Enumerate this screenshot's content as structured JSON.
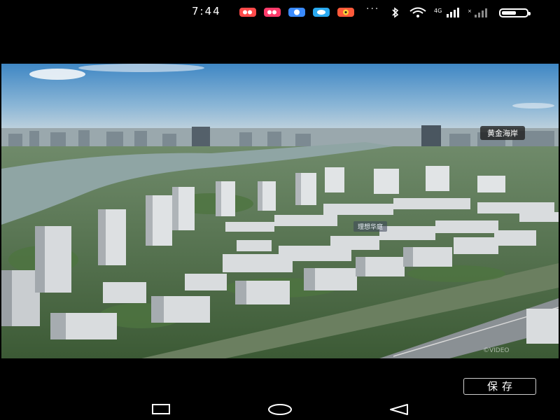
{
  "status_bar": {
    "time": "7:44",
    "more": "···",
    "notifications": [
      {
        "icon": "red-app-icon",
        "color": "#ff4a4a"
      },
      {
        "icon": "red-app-icon",
        "color": "#ff3b6b"
      },
      {
        "icon": "blue-app-icon",
        "color": "#3a8bff"
      },
      {
        "icon": "blue-app-icon",
        "color": "#29a9f0"
      },
      {
        "icon": "weibo-icon",
        "color": "#ff5a3a"
      }
    ],
    "network_label": "4G"
  },
  "media": {
    "place_tag": "黄金海岸",
    "mid_tag": "理想华庭",
    "watermark": "©VIDEO"
  },
  "actions": {
    "save_label": "保存"
  },
  "nav_bar": {
    "recent_icon": "square-icon",
    "home_icon": "circle-icon",
    "back_icon": "triangle-back-icon"
  }
}
